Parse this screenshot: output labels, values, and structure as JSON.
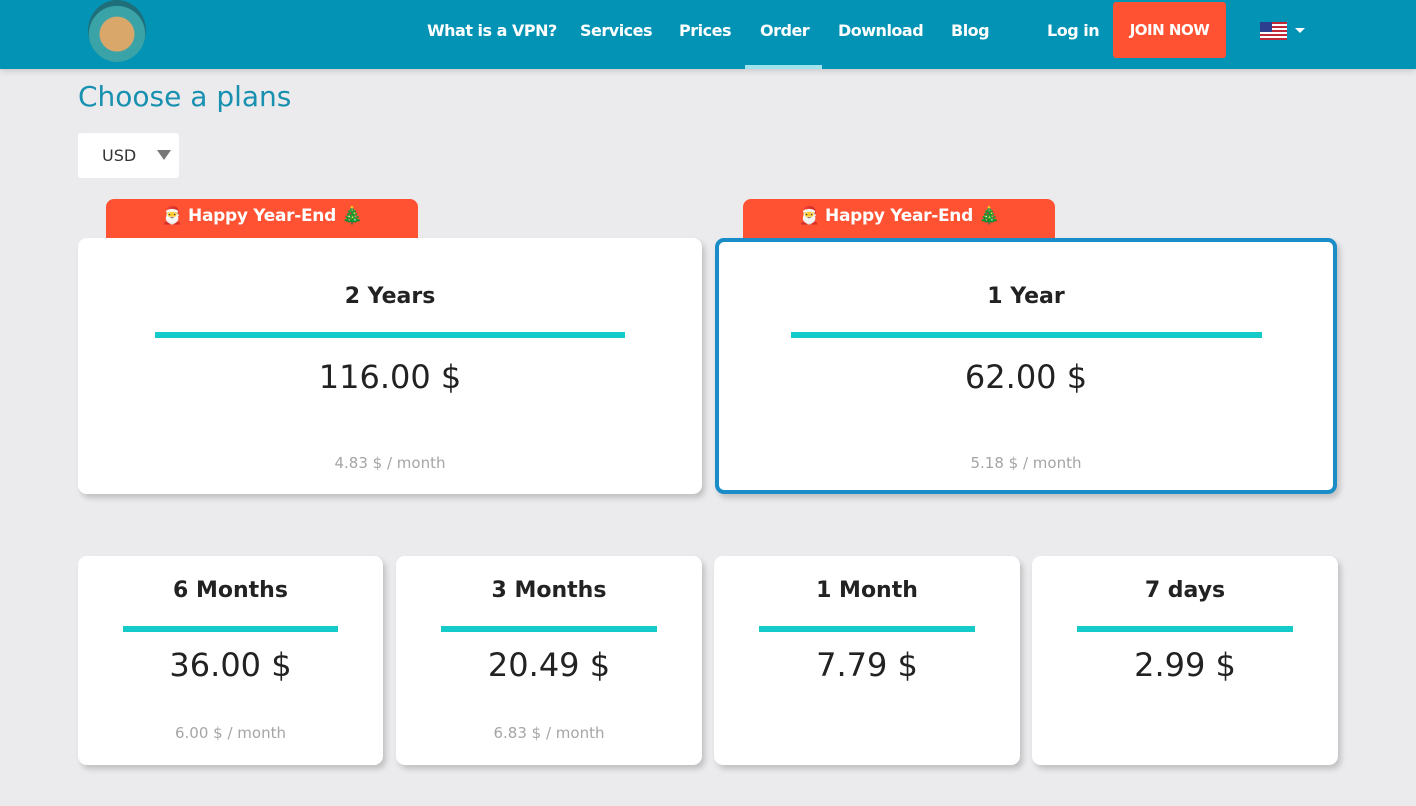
{
  "header": {
    "nav": [
      "What is a VPN?",
      "Services",
      "Prices",
      "Order",
      "Download",
      "Blog"
    ],
    "active": "Order",
    "login": "Log in",
    "join": "JOIN NOW",
    "language": "us-flag-icon"
  },
  "page": {
    "title": "Choose a plans",
    "currency": "USD"
  },
  "promo": "🎅 Happy Year-End 🎄",
  "colors": {
    "header": "#0393b4",
    "accent": "#ff5233",
    "bar": "#15cbc9",
    "selected": "#1a8dc8"
  },
  "plans": [
    {
      "name": "2 Years",
      "price": "116.00 $",
      "monthly": "4.83 $ / month",
      "selected": false
    },
    {
      "name": "1 Year",
      "price": "62.00 $",
      "monthly": "5.18 $ / month",
      "selected": true
    },
    {
      "name": "6 Months",
      "price": "36.00 $",
      "monthly": "6.00 $ / month"
    },
    {
      "name": "3 Months",
      "price": "20.49 $",
      "monthly": "6.83 $ / month"
    },
    {
      "name": "1 Month",
      "price": "7.79 $"
    },
    {
      "name": "7 days",
      "price": "2.99 $"
    }
  ]
}
